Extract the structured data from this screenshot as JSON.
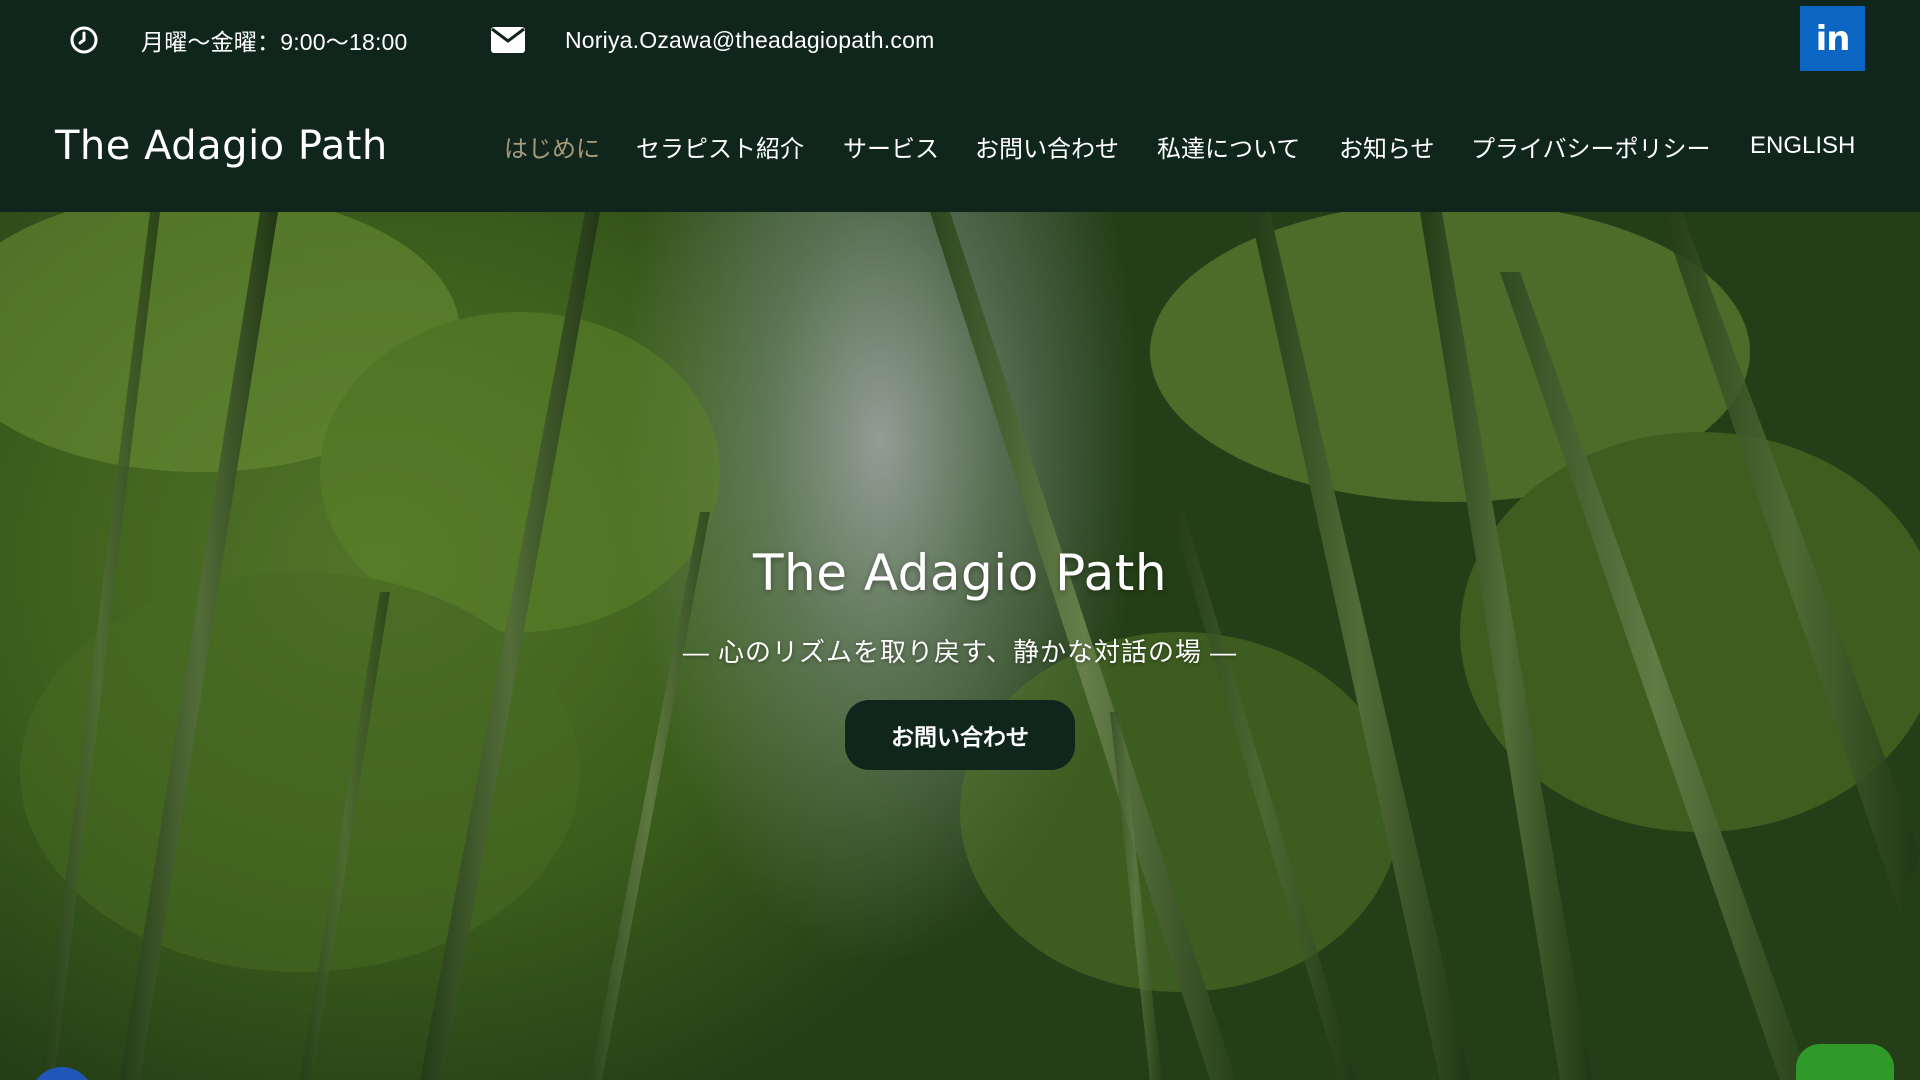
{
  "topbar": {
    "clock_icon": "clock-icon",
    "hours": "月曜～金曜：9:00～18:00",
    "mail_icon": "envelope-icon",
    "email": "Noriya.Ozawa@theadagiopath.com",
    "linkedin_label": "in",
    "linkedin_color": "#0a66c2"
  },
  "header": {
    "brand": "The Adagio Path",
    "nav": [
      {
        "label": "はじめに",
        "active": true
      },
      {
        "label": "セラピスト紹介",
        "active": false
      },
      {
        "label": "サービス",
        "active": false
      },
      {
        "label": "お問い合わせ",
        "active": false
      },
      {
        "label": "私達について",
        "active": false
      },
      {
        "label": "お知らせ",
        "active": false
      },
      {
        "label": "プライバシーポリシー",
        "active": false
      },
      {
        "label": "ENGLISH",
        "active": false
      }
    ],
    "active_color": "#a59a7c"
  },
  "hero": {
    "title": "The Adagio Path",
    "subtitle": "― 心のリズムを取り戻す、静かな対話の場 ―",
    "cta_label": "お問い合わせ",
    "background": "bamboo forest photo"
  },
  "colors": {
    "dark_green": "#10251b",
    "white": "#ffffff"
  }
}
